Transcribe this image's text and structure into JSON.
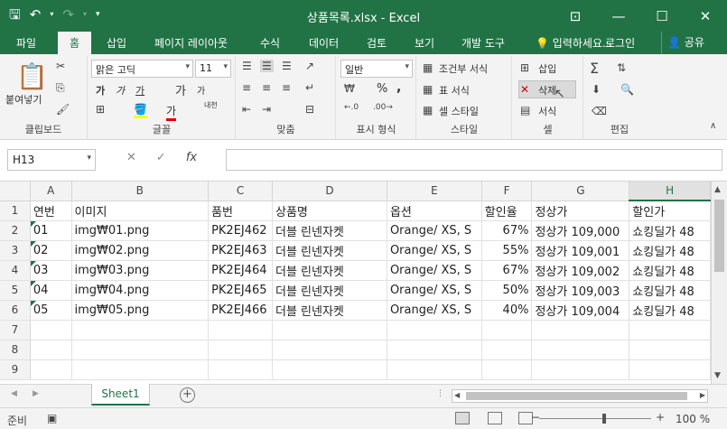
{
  "window": {
    "title": "상품목록.xlsx - Excel",
    "controls": [
      "⊡",
      "—",
      "☐",
      "✕"
    ]
  },
  "tabs": [
    "파일",
    "홈",
    "삽입",
    "페이지 레이아웃",
    "수식",
    "데이터",
    "검토",
    "보기",
    "개발 도구"
  ],
  "tell_me": "입력하세요...",
  "login": "로그인",
  "share": "공유",
  "ribbon": {
    "clipboard": {
      "paste": "붙여넣기",
      "label": "클립보드"
    },
    "font": {
      "name": "맑은 고딕",
      "size": "11",
      "bold": "가",
      "italic": "가",
      "underline": "가",
      "grow": "가",
      "shrink": "가",
      "phonetic": "내천",
      "color": "가",
      "label": "글꼴"
    },
    "alignment": {
      "label": "맞춤"
    },
    "number": {
      "format": "일반",
      "percent": "%",
      "comma": ",",
      "label": "표시 형식"
    },
    "styles": {
      "conditional": "조건부 서식",
      "table": "표 서식",
      "cell": "셀 스타일",
      "label": "스타일"
    },
    "cells": {
      "insert": "삽입",
      "delete": "삭제",
      "format": "서식",
      "label": "셀"
    },
    "editing": {
      "label": "편집"
    }
  },
  "formula_bar": {
    "name_box": "H13",
    "fx": "fx",
    "value": ""
  },
  "sheet": {
    "columns": [
      "A",
      "B",
      "C",
      "D",
      "E",
      "F",
      "G",
      "H"
    ],
    "rows": [
      [
        "연번",
        "이미지",
        "품번",
        "상품명",
        "옵션",
        "할인율",
        "정상가",
        "할인가"
      ],
      [
        "01",
        "img₩01.png",
        "PK2EJ462",
        "더블 린넨자켓",
        "Orange/ XS, S",
        "67%",
        "정상가 109,000",
        "쇼킹딜가 48"
      ],
      [
        "02",
        "img₩02.png",
        "PK2EJ463",
        "더블 린넨자켓",
        "Orange/ XS, S",
        "55%",
        "정상가 109,001",
        "쇼킹딜가 48"
      ],
      [
        "03",
        "img₩03.png",
        "PK2EJ464",
        "더블 린넨자켓",
        "Orange/ XS, S",
        "67%",
        "정상가 109,002",
        "쇼킹딜가 48"
      ],
      [
        "04",
        "img₩04.png",
        "PK2EJ465",
        "더블 린넨자켓",
        "Orange/ XS, S",
        "50%",
        "정상가 109,003",
        "쇼킹딜가 48"
      ],
      [
        "05",
        "img₩05.png",
        "PK2EJ466",
        "더블 린넨자켓",
        "Orange/ XS, S",
        "40%",
        "정상가 109,004",
        "쇼킹딜가 48"
      ],
      [
        "",
        "",
        "",
        "",
        "",
        "",
        "",
        ""
      ],
      [
        "",
        "",
        "",
        "",
        "",
        "",
        "",
        ""
      ],
      [
        "",
        "",
        "",
        "",
        "",
        "",
        "",
        ""
      ]
    ],
    "row_numbers": [
      "1",
      "2",
      "3",
      "4",
      "5",
      "6",
      "7",
      "8",
      "9"
    ],
    "selected_column": "H"
  },
  "sheet_tab": "Sheet1",
  "status": {
    "ready": "준비",
    "zoom": "100 %"
  },
  "colors": {
    "accent": "#217346"
  }
}
